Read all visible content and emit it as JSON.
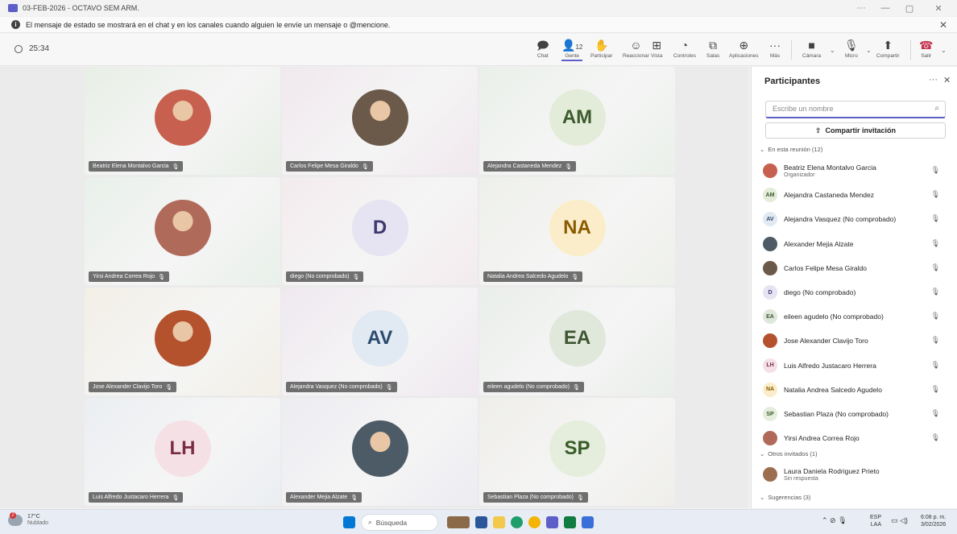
{
  "window": {
    "title": "03-FEB-2026 - OCTAVO SEM ARM.",
    "controls": [
      "···",
      "—",
      "▢",
      "✕"
    ]
  },
  "banner": {
    "text": "El mensaje de estado se mostrará en el chat y en los canales cuando alguien le envíe un mensaje o @mencione."
  },
  "meeting": {
    "timer": "25:34",
    "toolbar": [
      {
        "label": "Chat",
        "icon": "chat-icon",
        "glyph": "🗩"
      },
      {
        "label": "Gente",
        "icon": "people-icon",
        "glyph": "👤",
        "count": "12"
      },
      {
        "label": "Participar",
        "icon": "raise-hand-icon",
        "glyph": "✋"
      },
      {
        "label": "Reaccionar",
        "icon": "react-icon",
        "glyph": "☺"
      },
      {
        "label": "Vista",
        "icon": "view-icon",
        "glyph": "⊞"
      },
      {
        "label": "Controles",
        "icon": "controls-icon",
        "glyph": "◔"
      },
      {
        "label": "Salas",
        "icon": "rooms-icon",
        "glyph": "⧉"
      },
      {
        "label": "Aplicaciones",
        "icon": "apps-icon",
        "glyph": "⊕"
      },
      {
        "label": "Más",
        "icon": "more-icon",
        "glyph": "···"
      }
    ],
    "devices": [
      {
        "label": "Cámara",
        "icon": "camera-off-icon",
        "glyph": "■"
      },
      {
        "label": "Micro",
        "icon": "mic-off-icon",
        "glyph": "🎙"
      },
      {
        "label": "Compartir",
        "icon": "share-screen-icon",
        "glyph": "⬆"
      },
      {
        "label": "Salir",
        "icon": "hang-up-icon",
        "glyph": "☎"
      }
    ]
  },
  "tiles": [
    {
      "name": "Beatriz Elena Montalvo Garcia",
      "initials": "",
      "photo": true,
      "bg": "#e8efe6",
      "av": "#c7604f"
    },
    {
      "name": "Carlos Felipe Mesa Giraldo",
      "initials": "",
      "photo": true,
      "bg": "#f0e8ee",
      "av": "#6b5a49"
    },
    {
      "name": "Alejandra Castaneda Mendez",
      "initials": "AM",
      "photo": false,
      "bg": "#eaf0ea",
      "av": "#e3ecd9",
      "fg": "#3c5a2d"
    },
    {
      "name": "Yirsi Andrea Correa Rojo",
      "initials": "",
      "photo": true,
      "bg": "#e9f0ea",
      "av": "#b06a5a"
    },
    {
      "name": "diego (No comprobado)",
      "initials": "D",
      "photo": false,
      "bg": "#f3ebee",
      "av": "#e6e3f3",
      "fg": "#3e3a6d"
    },
    {
      "name": "Natalia Andrea Salcedo Agudelo",
      "initials": "NA",
      "photo": false,
      "bg": "#eef0ea",
      "av": "#fbedc9",
      "fg": "#8a5a00"
    },
    {
      "name": "Jose Alexander Clavijo Toro",
      "initials": "",
      "photo": true,
      "bg": "#f2efe6",
      "av": "#b4522e"
    },
    {
      "name": "Alejandra Vasquez (No comprobado)",
      "initials": "AV",
      "photo": false,
      "bg": "#efe8f0",
      "av": "#e1e9f2",
      "fg": "#2a4a6e"
    },
    {
      "name": "eileen agudelo (No comprobado)",
      "initials": "EA",
      "photo": false,
      "bg": "#eaeeea",
      "av": "#e0e8dc",
      "fg": "#3d5531"
    },
    {
      "name": "Luis Alfredo Justacaro Herrera",
      "initials": "LH",
      "photo": false,
      "bg": "#ebeef2",
      "av": "#f5e0e6",
      "fg": "#7a2c44"
    },
    {
      "name": "Alexander Mejia Alzate",
      "initials": "",
      "photo": true,
      "bg": "#ececf2",
      "av": "#4d5b66"
    },
    {
      "name": "Sebastian Plaza (No comprobado)",
      "initials": "SP",
      "photo": false,
      "bg": "#efeeea",
      "av": "#e5eedd",
      "fg": "#385c28"
    }
  ],
  "panel": {
    "title": "Participantes",
    "more": "···",
    "close": "✕",
    "search_placeholder": "Escribe un nombre",
    "share_label": "Compartir invitación",
    "section_in_meeting": "En esta reunión (12)",
    "participants": [
      {
        "name": "Beatriz Elena Montalvo Garcia",
        "sub": "Organizador",
        "initials": "",
        "av": "#c7604f",
        "fg": "#fff"
      },
      {
        "name": "Alejandra Castaneda Mendez",
        "sub": "",
        "initials": "AM",
        "av": "#e3ecd9",
        "fg": "#3c5a2d"
      },
      {
        "name": "Alejandra Vasquez (No comprobado)",
        "sub": "",
        "initials": "AV",
        "av": "#e1e9f2",
        "fg": "#2a4a6e"
      },
      {
        "name": "Alexander Mejia Alzate",
        "sub": "",
        "initials": "",
        "av": "#4d5b66",
        "fg": "#fff"
      },
      {
        "name": "Carlos Felipe Mesa Giraldo",
        "sub": "",
        "initials": "",
        "av": "#6b5a49",
        "fg": "#fff"
      },
      {
        "name": "diego (No comprobado)",
        "sub": "",
        "initials": "D",
        "av": "#e6e3f3",
        "fg": "#3e3a6d"
      },
      {
        "name": "eileen agudelo (No comprobado)",
        "sub": "",
        "initials": "EA",
        "av": "#e0e8dc",
        "fg": "#3d5531"
      },
      {
        "name": "Jose Alexander Clavijo Toro",
        "sub": "",
        "initials": "",
        "av": "#b4522e",
        "fg": "#fff"
      },
      {
        "name": "Luis Alfredo Justacaro Herrera",
        "sub": "",
        "initials": "LH",
        "av": "#f5e0e6",
        "fg": "#7a2c44"
      },
      {
        "name": "Natalia Andrea Salcedo Agudelo",
        "sub": "",
        "initials": "NA",
        "av": "#fbedc9",
        "fg": "#8a5a00"
      },
      {
        "name": "Sebastian Plaza (No comprobado)",
        "sub": "",
        "initials": "SP",
        "av": "#e5eedd",
        "fg": "#385c28"
      },
      {
        "name": "Yirsi Andrea Correa Rojo",
        "sub": "",
        "initials": "",
        "av": "#b06a5a",
        "fg": "#fff"
      }
    ],
    "section_invited": "Otros invitados (1)",
    "invited": {
      "name": "Laura Daniela Rodriguez Prieto",
      "sub": "Sin respuesta",
      "av": "#9b6e4f"
    },
    "section_suggestions": "Sugerencias (3)"
  },
  "taskbar": {
    "weather_temp": "17°C",
    "weather_desc": "Nublado",
    "weather_badge": "2",
    "search_label": "Búsqueda",
    "lang_top": "ESP",
    "lang_bottom": "LAA",
    "time": "6:08 p. m.",
    "date": "3/02/2026"
  },
  "colors": {
    "accent": "#5b5fc7",
    "hangup": "#c4314b"
  }
}
